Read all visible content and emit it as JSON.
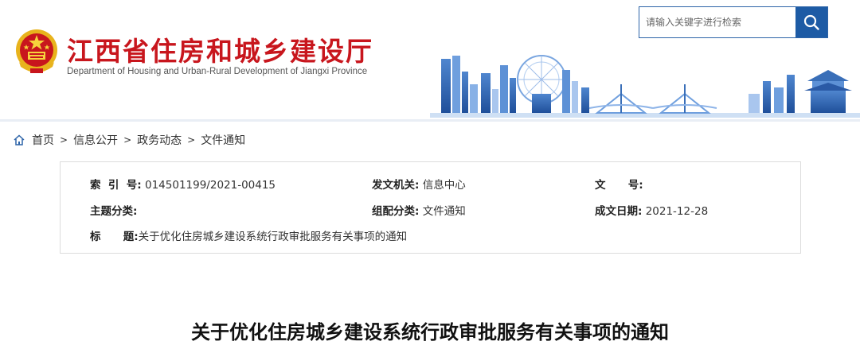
{
  "site": {
    "title_cn": "江西省住房和城乡建设厅",
    "title_en": "Department of Housing and Urban-Rural Development of Jiangxi Province"
  },
  "search": {
    "placeholder": "请输入关键字进行检索"
  },
  "breadcrumb": {
    "items": [
      "首页",
      "信息公开",
      "政务动态",
      "文件通知"
    ],
    "separator": ">"
  },
  "meta": {
    "index_label": "索  引  号:",
    "index_value": "014501199/2021-00415",
    "issuer_label": "发文机关:",
    "issuer_value": "信息中心",
    "docno_label": "文      号:",
    "docno_value": "",
    "subject_label": "主题分类:",
    "subject_value": "",
    "category_label": "组配分类:",
    "category_value": "文件通知",
    "date_label": "成文日期:",
    "date_value": "2021-12-28",
    "title_label": "标      题:",
    "title_value": "关于优化住房城乡建设系统行政审批服务有关事项的通知"
  },
  "article": {
    "title": "关于优化住房城乡建设系统行政审批服务有关事项的通知"
  },
  "colors": {
    "brand_red": "#c8161d",
    "search_blue": "#1d5ba5",
    "skyline_blue": "#5b8fd0"
  },
  "icons": {
    "search": "magnifier-icon",
    "home": "home-icon",
    "emblem": "national-emblem-icon"
  }
}
